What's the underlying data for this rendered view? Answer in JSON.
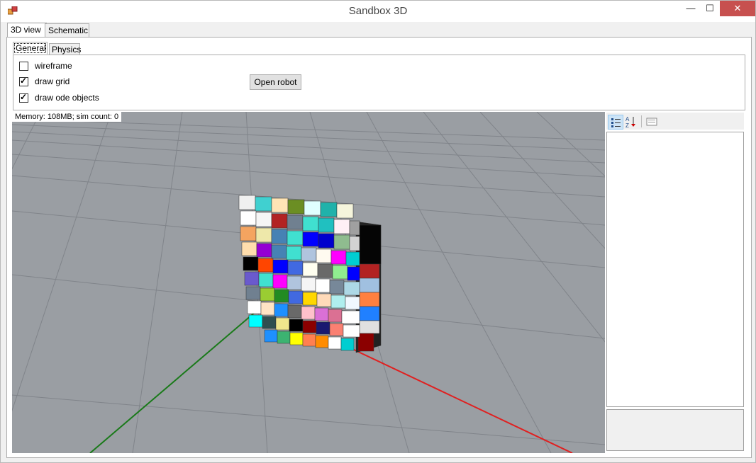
{
  "window": {
    "title": "Sandbox 3D",
    "minimize": "—",
    "maximize": "☐",
    "close": "✕"
  },
  "tabs": [
    {
      "label": "3D view"
    },
    {
      "label": "Schematic"
    }
  ],
  "subtabs": [
    {
      "label": "General"
    },
    {
      "label": "Physics"
    }
  ],
  "general": {
    "wireframe": {
      "label": "wireframe",
      "checked": false
    },
    "draw_grid": {
      "label": "draw grid",
      "checked": true
    },
    "draw_ode_objects": {
      "label": "draw ode objects",
      "checked": true
    },
    "open_robot_button": "Open robot"
  },
  "viewport": {
    "status": "Memory: 108MB; sim count: 0"
  },
  "colors": {
    "axis_green": "#1a7a1a",
    "axis_red": "#e02020",
    "background": "#9a9ea3",
    "grid": "#7c8086"
  }
}
